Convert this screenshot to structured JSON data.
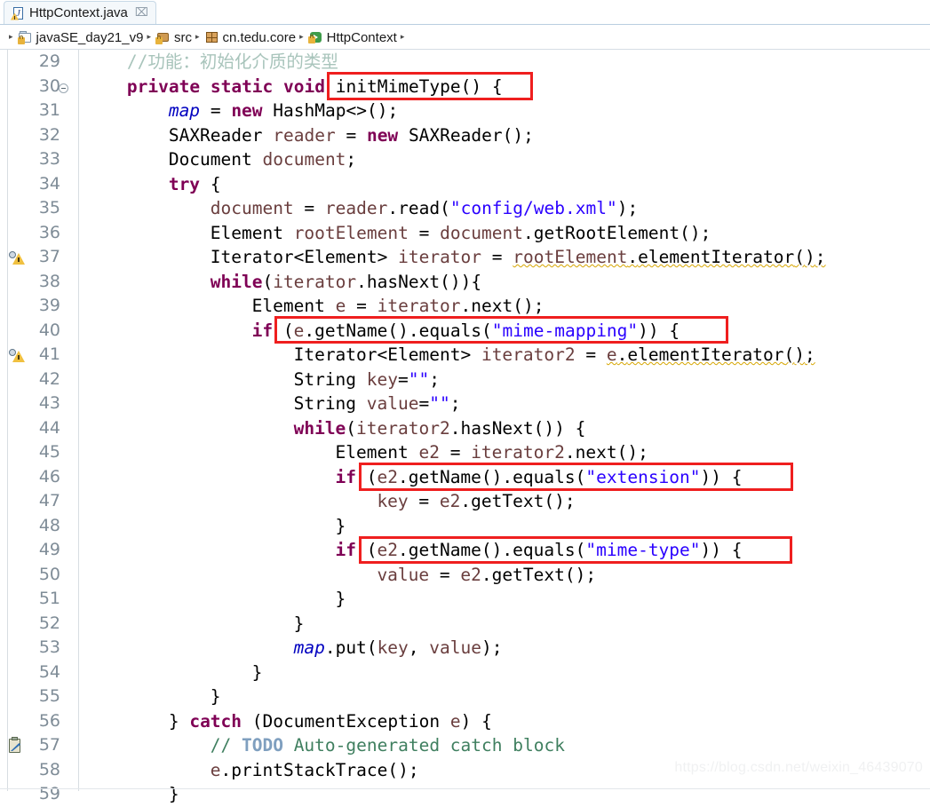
{
  "window": {
    "tab": {
      "title": "HttpContext.java",
      "icon": "java-file-warning-icon",
      "close_glyph": "⌧"
    }
  },
  "breadcrumb": {
    "separator": "▸",
    "items": [
      {
        "label": "javaSE_day21_v9",
        "icon": "java-project-icon"
      },
      {
        "label": "src",
        "icon": "source-folder-icon"
      },
      {
        "label": "cn.tedu.core",
        "icon": "package-icon"
      },
      {
        "label": "HttpContext",
        "icon": "java-class-icon"
      }
    ]
  },
  "editor": {
    "language": "java",
    "first_line_number": 29,
    "lines": [
      {
        "n": "29",
        "marker": "none",
        "indent": 4,
        "text": "//功能：初始化介质的类型"
      },
      {
        "n": "30",
        "marker": "fold",
        "indent": 4,
        "text": "private static void initMimeType() {"
      },
      {
        "n": "31",
        "marker": "none",
        "indent": 8,
        "text": "map = new HashMap<>();"
      },
      {
        "n": "32",
        "marker": "none",
        "indent": 8,
        "text": "SAXReader reader = new SAXReader();"
      },
      {
        "n": "33",
        "marker": "none",
        "indent": 8,
        "text": "Document document;"
      },
      {
        "n": "34",
        "marker": "none",
        "indent": 8,
        "text": "try {"
      },
      {
        "n": "35",
        "marker": "none",
        "indent": 12,
        "text": "document = reader.read(\"config/web.xml\");"
      },
      {
        "n": "36",
        "marker": "none",
        "indent": 12,
        "text": "Element rootElement = document.getRootElement();"
      },
      {
        "n": "37",
        "marker": "warning",
        "indent": 12,
        "text": "Iterator<Element> iterator = rootElement.elementIterator();"
      },
      {
        "n": "38",
        "marker": "none",
        "indent": 12,
        "text": "while(iterator.hasNext()){"
      },
      {
        "n": "39",
        "marker": "none",
        "indent": 16,
        "text": "Element e = iterator.next();"
      },
      {
        "n": "40",
        "marker": "none",
        "indent": 16,
        "text": "if (e.getName().equals(\"mime-mapping\")) {"
      },
      {
        "n": "41",
        "marker": "warning",
        "indent": 20,
        "text": "Iterator<Element> iterator2 = e.elementIterator();"
      },
      {
        "n": "42",
        "marker": "none",
        "indent": 20,
        "text": "String key=\"\";"
      },
      {
        "n": "43",
        "marker": "none",
        "indent": 20,
        "text": "String value=\"\";"
      },
      {
        "n": "44",
        "marker": "none",
        "indent": 20,
        "text": "while(iterator2.hasNext()) {"
      },
      {
        "n": "45",
        "marker": "none",
        "indent": 24,
        "text": "Element e2 = iterator2.next();"
      },
      {
        "n": "46",
        "marker": "none",
        "indent": 24,
        "text": "if (e2.getName().equals(\"extension\")) {"
      },
      {
        "n": "47",
        "marker": "none",
        "indent": 28,
        "text": "key = e2.getText();"
      },
      {
        "n": "48",
        "marker": "none",
        "indent": 24,
        "text": "}"
      },
      {
        "n": "49",
        "marker": "none",
        "indent": 24,
        "text": "if (e2.getName().equals(\"mime-type\")) {"
      },
      {
        "n": "50",
        "marker": "none",
        "indent": 28,
        "text": "value = e2.getText();"
      },
      {
        "n": "51",
        "marker": "none",
        "indent": 24,
        "text": "}"
      },
      {
        "n": "52",
        "marker": "none",
        "indent": 20,
        "text": "}"
      },
      {
        "n": "53",
        "marker": "none",
        "indent": 20,
        "text": "map.put(key, value);"
      },
      {
        "n": "54",
        "marker": "none",
        "indent": 16,
        "text": "}"
      },
      {
        "n": "55",
        "marker": "none",
        "indent": 12,
        "text": "}"
      },
      {
        "n": "56",
        "marker": "none",
        "indent": 8,
        "text": "} catch (DocumentException e) {"
      },
      {
        "n": "57",
        "marker": "task",
        "indent": 12,
        "text": "// TODO Auto-generated catch block"
      },
      {
        "n": "58",
        "marker": "none",
        "indent": 12,
        "text": "e.printStackTrace();"
      },
      {
        "n": "59",
        "marker": "none",
        "indent": 8,
        "text": "}"
      }
    ],
    "annotations": [
      {
        "label": "highlight-init-mime-type",
        "line": "30",
        "color": "#ef1f1f"
      },
      {
        "label": "highlight-mime-mapping-if",
        "line": "40",
        "color": "#ef1f1f"
      },
      {
        "label": "highlight-extension-if",
        "line": "46",
        "color": "#ef1f1f"
      },
      {
        "label": "highlight-mime-type-if",
        "line": "49",
        "color": "#ef1f1f"
      }
    ]
  },
  "watermark": {
    "text": "https://blog.csdn.net/weixin_46439070"
  },
  "colors": {
    "keyword": "#7f0055",
    "string": "#2a00ff",
    "comment": "#3f7f5f",
    "field": "#0000c0",
    "parameter": "#6a3e3e",
    "todo": "#7f9fbf",
    "annotation_box": "#ef1f1f",
    "line_number": "#7f8c97",
    "background": "#ffffff"
  }
}
